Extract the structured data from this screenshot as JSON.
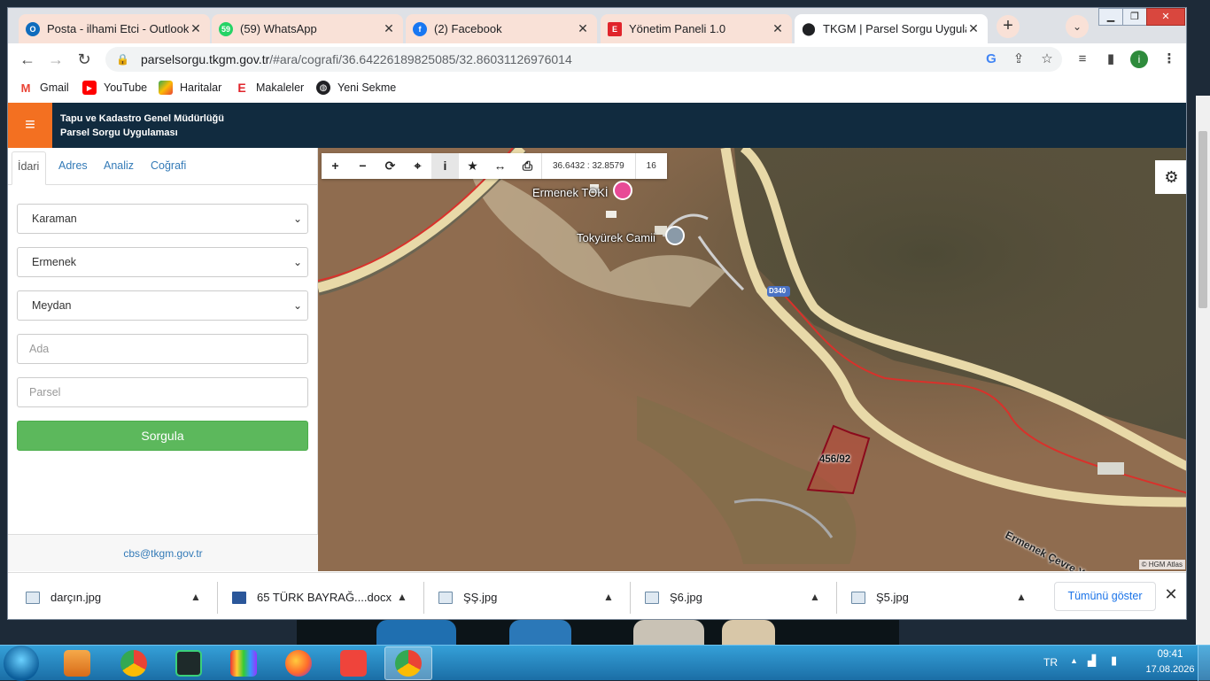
{
  "browser": {
    "tabs": [
      {
        "title": "Posta - ilhami Etci - Outlook",
        "icon": "outlook-icon",
        "color": "#0f6cbd"
      },
      {
        "title": "(59) WhatsApp",
        "icon": "whatsapp-icon",
        "color": "#25d366",
        "badge": "59"
      },
      {
        "title": "(2) Facebook",
        "icon": "facebook-icon",
        "color": "#1877f2"
      },
      {
        "title": "Yönetim Paneli 1.0",
        "icon": "e-logo-icon",
        "color": "#e0242b"
      },
      {
        "title": "TKGM | Parsel Sorgu Uygulam",
        "icon": "location-pin-icon",
        "color": "#202124"
      }
    ],
    "url_host": "parselsorgu.tkgm.gov.tr",
    "url_rest": "/#ara/cografi/36.64226189825085/32.86031126976014",
    "profile_initial": "i",
    "bookmarks": [
      {
        "label": "Gmail",
        "icon": "gmail-icon",
        "color": "#ea4335"
      },
      {
        "label": "YouTube",
        "icon": "youtube-icon",
        "color": "#ff0000"
      },
      {
        "label": "Haritalar",
        "icon": "maps-icon",
        "color": "#34a853"
      },
      {
        "label": "Makaleler",
        "icon": "e-logo-icon",
        "color": "#e0242b"
      },
      {
        "label": "Yeni Sekme",
        "icon": "globe-icon",
        "color": "#202124"
      }
    ]
  },
  "app": {
    "org_line1": "Tapu ve Kadastro Genel Müdürlüğü",
    "org_line2": "Parsel Sorgu Uygulaması",
    "header_bg": "#112b3f",
    "menu_bg": "#f37021"
  },
  "sidebar": {
    "tabs": [
      "İdari",
      "Adres",
      "Analiz",
      "Coğrafi"
    ],
    "active_tab": "İdari",
    "selects": [
      {
        "name": "il",
        "value": "Karaman"
      },
      {
        "name": "ilce",
        "value": "Ermenek"
      },
      {
        "name": "mahalle",
        "value": "Meydan"
      }
    ],
    "ada_placeholder": "Ada",
    "parsel_placeholder": "Parsel",
    "submit_label": "Sorgula",
    "footer_email": "cbs@tkgm.gov.tr"
  },
  "map": {
    "coords": "36.6432 : 32.8579",
    "zoom": "16",
    "tools": [
      "zoom-in-icon",
      "zoom-out-icon",
      "refresh-icon",
      "crosshair-icon",
      "info-icon",
      "star-icon",
      "measure-icon",
      "print-icon"
    ],
    "labels": {
      "toki": "Ermenek TOKİ",
      "camii": "Tokyürek Camii",
      "road_shield": "D340",
      "parcel": "456/92",
      "ring_road": "Ermenek Çevre Yolu"
    },
    "attribution": "© HGM Atlas"
  },
  "downloads": {
    "items": [
      "darçın.jpg",
      "65 TÜRK BAYRAĞ....docx",
      "ŞŞ.jpg",
      "Ş6.jpg",
      "Ş5.jpg"
    ],
    "show_all": "Tümünü göster"
  },
  "taskbar": {
    "lang": "TR",
    "time": "09:41",
    "date": "17.08.2026"
  }
}
